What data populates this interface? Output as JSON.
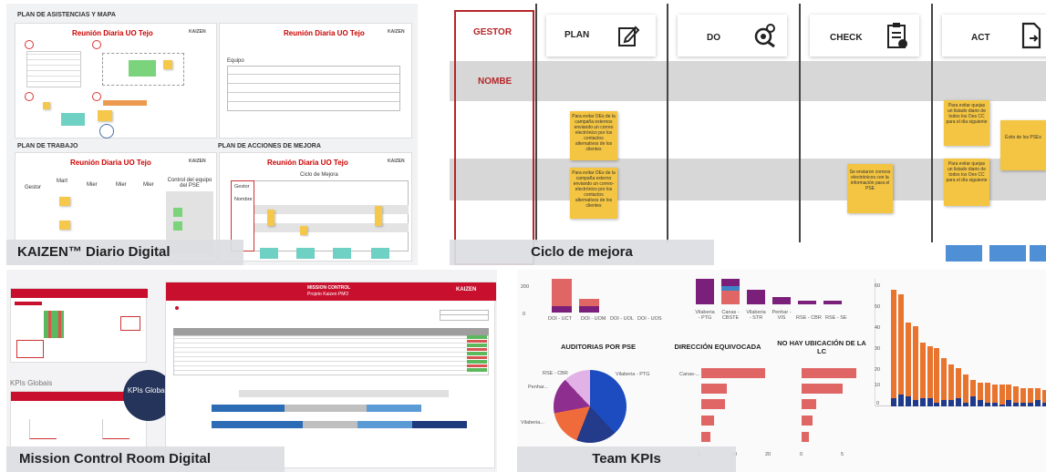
{
  "panels": {
    "kaizen": {
      "caption": "KAIZEN™ Diario Digital",
      "sec1": "PLAN DE ASISTENCIAS Y MAPA",
      "sec2": "PLAN DE TRABAJO",
      "sec3": "PLAN DE ACCIONES DE MEJORA",
      "board_title": "Reunión Diaria UO Tejo",
      "logo": "KAIZEN",
      "equipo": "Equipo",
      "gestor": "Gestor",
      "mart": "Mart",
      "mier": "Mier",
      "control": "Control del equipo del PSE",
      "ciclo": "Ciclo de Mejora",
      "nombre": "Nombre"
    },
    "cycle": {
      "caption": "Ciclo de mejora",
      "gestor": "GESTOR",
      "nombre": "NOMBE",
      "plan": "PLAN",
      "do": "DO",
      "check": "CHECK",
      "act": "ACT",
      "note1": "Para evitar OEs de la campaña externos enviando un correo electrónico por los contactos alternativos de los clientes",
      "note2": "Para evitar OEs de la campaña externo enviando un correo-electrónico por los contactos alternativos de los clientes",
      "note3": "Se enviaron correos electrónicos con la información para el PSE",
      "note4": "Para evitar quejas un listado diario de todos los Oes CC para el día siguiente",
      "note5": "Para evitar quejas un listado diario de todos los Oes CC para el día siguiente",
      "note6": "Éxito de los PSEs"
    },
    "mission": {
      "caption": "Mission Control Room Digital",
      "header": "MISSION CONTROL",
      "subheader": "Projeto Kaizen PMO",
      "kpis_label": "KPIs Globais",
      "kpis_circle": "KPIs Globais",
      "logo": "KAIZEN"
    },
    "teamkpis": {
      "caption": "Team KPIs",
      "title1": "AUDITORIAS POR PSE",
      "title2": "DIRECCIÓN EQUIVOCADA",
      "title3": "NO HAY UBICACIÓN DE LA LC",
      "pie_labels": [
        "RSE - CBR",
        "Vilaberia - PTG",
        "Penhar...",
        "Vilaberia..."
      ],
      "top_labels": [
        "DOI - UCT",
        "DOI - UOM",
        "DOI - UOL",
        "DOI - UOS"
      ],
      "top_labels2": [
        "Vilaberia - PTG",
        "Canas - CBSTE",
        "Vilaberia - STR",
        "Penhar - VIS",
        "RSE - CBR",
        "RSE - SE"
      ],
      "y_ticks": [
        "60",
        "50",
        "40",
        "30",
        "20",
        "10",
        "0"
      ],
      "ax_small": [
        "0",
        "10",
        "20"
      ],
      "ax_small2": [
        "0",
        "5"
      ],
      "top_ticks": [
        "200",
        "0"
      ]
    }
  }
}
